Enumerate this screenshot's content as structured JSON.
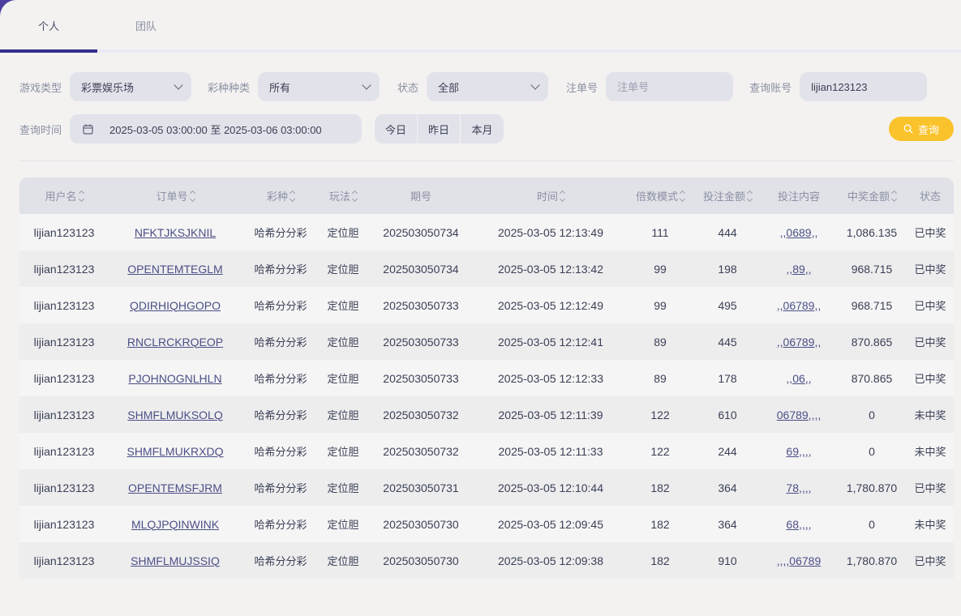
{
  "tabs": [
    {
      "label": "个人",
      "active": true
    },
    {
      "label": "团队",
      "active": false
    }
  ],
  "filters": {
    "game_type_label": "游戏类型",
    "game_type_value": "彩票娱乐场",
    "lottery_label": "彩种种类",
    "lottery_value": "所有",
    "status_label": "状态",
    "status_value": "全部",
    "order_label": "注单号",
    "order_placeholder": "注单号",
    "account_label": "查询账号",
    "account_value": "lijian123123",
    "time_label": "查询时间",
    "time_value": "2025-03-05 03:00:00 至 2025-03-06 03:00:00",
    "quick": [
      "今日",
      "昨日",
      "本月"
    ],
    "query_button": "查询"
  },
  "table": {
    "headers": [
      "用户名",
      "订单号",
      "彩种",
      "玩法",
      "期号",
      "时间",
      "倍数模式",
      "投注金额",
      "投注内容",
      "中奖金额",
      "状态"
    ],
    "rows": [
      [
        "lijian123123",
        "NFKTJKSJKNIL",
        "哈希分分彩",
        "定位胆",
        "202503050734",
        "2025-03-05 12:13:49",
        "111",
        "444",
        ",,0689,,",
        "1,086.135",
        "已中奖"
      ],
      [
        "lijian123123",
        "OPENTEMTEGLM",
        "哈希分分彩",
        "定位胆",
        "202503050734",
        "2025-03-05 12:13:42",
        "99",
        "198",
        ",,89,,",
        "968.715",
        "已中奖"
      ],
      [
        "lijian123123",
        "QDIRHIQHGOPO",
        "哈希分分彩",
        "定位胆",
        "202503050733",
        "2025-03-05 12:12:49",
        "99",
        "495",
        ",,06789,,",
        "968.715",
        "已中奖"
      ],
      [
        "lijian123123",
        "RNCLRCKRQEOP",
        "哈希分分彩",
        "定位胆",
        "202503050733",
        "2025-03-05 12:12:41",
        "89",
        "445",
        ",,06789,,",
        "870.865",
        "已中奖"
      ],
      [
        "lijian123123",
        "PJOHNOGNLHLN",
        "哈希分分彩",
        "定位胆",
        "202503050733",
        "2025-03-05 12:12:33",
        "89",
        "178",
        ",,06,,",
        "870.865",
        "已中奖"
      ],
      [
        "lijian123123",
        "SHMFLMUKSOLQ",
        "哈希分分彩",
        "定位胆",
        "202503050732",
        "2025-03-05 12:11:39",
        "122",
        "610",
        "06789,,,,",
        "0",
        "未中奖"
      ],
      [
        "lijian123123",
        "SHMFLMUKRXDQ",
        "哈希分分彩",
        "定位胆",
        "202503050732",
        "2025-03-05 12:11:33",
        "122",
        "244",
        "69,,,,",
        "0",
        "未中奖"
      ],
      [
        "lijian123123",
        "OPENTEMSFJRM",
        "哈希分分彩",
        "定位胆",
        "202503050731",
        "2025-03-05 12:10:44",
        "182",
        "364",
        "78,,,,",
        "1,780.870",
        "已中奖"
      ],
      [
        "lijian123123",
        "MLQJPQINWINK",
        "哈希分分彩",
        "定位胆",
        "202503050730",
        "2025-03-05 12:09:45",
        "182",
        "364",
        "68,,,,",
        "0",
        "未中奖"
      ],
      [
        "lijian123123",
        "SHMFLMUJSSIQ",
        "哈希分分彩",
        "定位胆",
        "202503050730",
        "2025-03-05 12:09:38",
        "182",
        "910",
        ",,,,06789",
        "1,780.870",
        "已中奖"
      ]
    ]
  },
  "colors": {
    "accent": "#352d8c",
    "query_button": "#fbc32b",
    "background": "#f3f2f1",
    "link": "#4b4f86"
  }
}
